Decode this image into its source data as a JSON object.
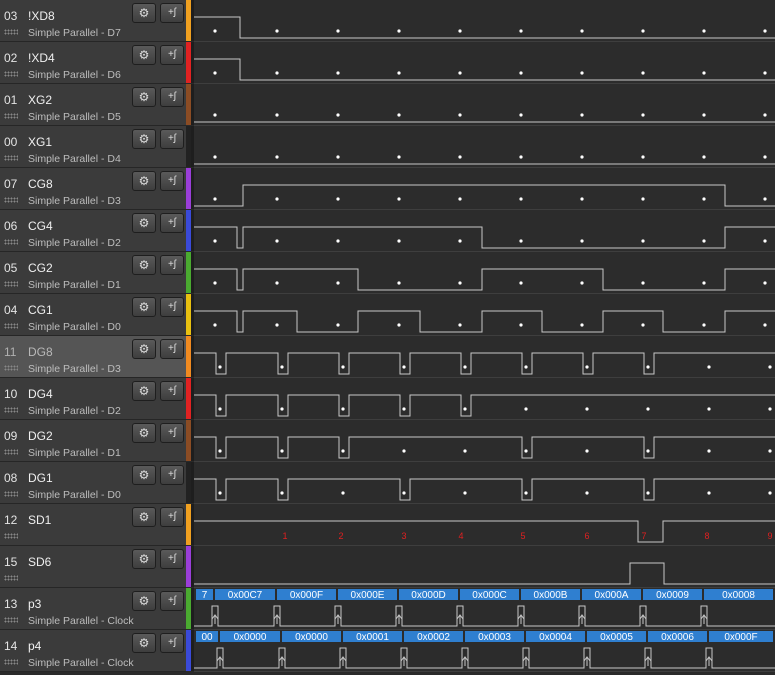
{
  "channels": [
    {
      "num": "03",
      "name": "!XD8",
      "sub": "Simple Parallel - D7",
      "color": "#f0a020"
    },
    {
      "num": "02",
      "name": "!XD4",
      "sub": "Simple Parallel - D6",
      "color": "#e02222"
    },
    {
      "num": "01",
      "name": "XG2",
      "sub": "Simple Parallel - D5",
      "color": "#8b4c24"
    },
    {
      "num": "00",
      "name": "XG1",
      "sub": "Simple Parallel - D4",
      "color": "#222222"
    },
    {
      "num": "07",
      "name": "CG8",
      "sub": "Simple Parallel - D3",
      "color": "#9a3ed8"
    },
    {
      "num": "06",
      "name": "CG4",
      "sub": "Simple Parallel - D2",
      "color": "#3a4ad8"
    },
    {
      "num": "05",
      "name": "CG2",
      "sub": "Simple Parallel - D1",
      "color": "#4aaa30"
    },
    {
      "num": "04",
      "name": "CG1",
      "sub": "Simple Parallel - D0",
      "color": "#e8c010"
    },
    {
      "num": "11",
      "name": "DG8",
      "sub": "Simple Parallel - D3",
      "color": "#f08a20",
      "highlight": true
    },
    {
      "num": "10",
      "name": "DG4",
      "sub": "Simple Parallel - D2",
      "color": "#e02222"
    },
    {
      "num": "09",
      "name": "DG2",
      "sub": "Simple Parallel - D1",
      "color": "#8b4c24"
    },
    {
      "num": "08",
      "name": "DG1",
      "sub": "Simple Parallel - D0",
      "color": "#222222"
    },
    {
      "num": "12",
      "name": "SD1",
      "sub": "",
      "color": "#f0a020"
    },
    {
      "num": "15",
      "name": "SD6",
      "sub": "",
      "color": "#9a3ed8"
    },
    {
      "num": "13",
      "name": "p3",
      "sub": "Simple Parallel - Clock",
      "color": "#4aaa30"
    },
    {
      "num": "14",
      "name": "p4",
      "sub": "Simple Parallel - Clock",
      "color": "#3a4ad8"
    }
  ],
  "markers": [
    "1",
    "2",
    "3",
    "4",
    "5",
    "6",
    "7",
    "8",
    "9"
  ],
  "p3_labels": [
    "7",
    "0x00C7",
    "0x000F",
    "0x000E",
    "0x000D",
    "0x000C",
    "0x000B",
    "0x000A",
    "0x0009",
    "0x0008"
  ],
  "p4_labels": [
    "00",
    "0x0000",
    "0x0000",
    "0x0001",
    "0x0002",
    "0x0003",
    "0x0004",
    "0x0005",
    "0x0006",
    "0x000F"
  ],
  "icons": {
    "settings": "gear-icon",
    "trigger": "trigger-edge-icon"
  },
  "colors": {
    "waveform": "#c8c8c8",
    "marker": "#e02020",
    "decode_bar": "#2f7fd0",
    "track_bg": "#2c2c2c"
  }
}
